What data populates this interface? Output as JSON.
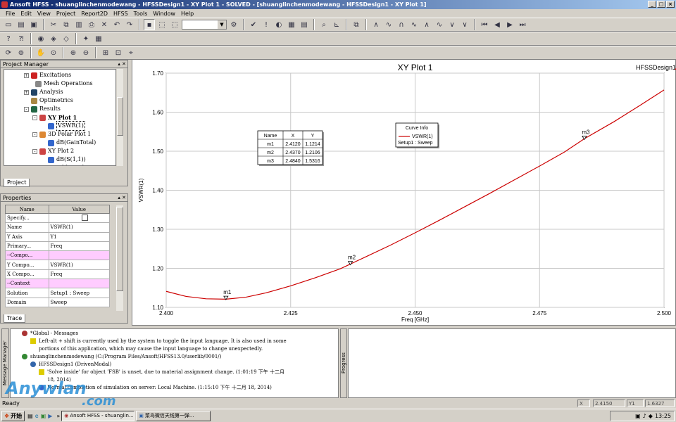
{
  "window": {
    "title": "Ansoft HFSS - shuanglinchenmodewang - HFSSDesign1 - XY Plot 1 - SOLVED - [shuanglinchenmodewang - HFSSDesign1 - XY Plot 1]",
    "buttons": [
      "_",
      "□",
      "×"
    ]
  },
  "menu": [
    "File",
    "Edit",
    "View",
    "Project",
    "Report2D",
    "HFSS",
    "Tools",
    "Window",
    "Help"
  ],
  "project_manager": {
    "title": "Project Manager",
    "tab": "Project",
    "items": [
      {
        "label": "Excitations",
        "expander": "+",
        "icon": "excitations-icon",
        "bold": false
      },
      {
        "label": "Mesh Operations",
        "expander": "",
        "icon": "mesh-icon",
        "bold": false
      },
      {
        "label": "Analysis",
        "expander": "+",
        "icon": "analysis-icon",
        "bold": false
      },
      {
        "label": "Optimetrics",
        "expander": "",
        "icon": "optimetrics-icon",
        "bold": false
      },
      {
        "label": "Results",
        "expander": "-",
        "icon": "results-icon",
        "bold": false
      },
      {
        "label": "XY Plot 1",
        "expander": "-",
        "icon": "xy-plot-icon",
        "bold": true
      },
      {
        "label": "VSWR(1)",
        "expander": "",
        "icon": "trace-icon",
        "bold": false,
        "selected": true
      },
      {
        "label": "3D Polar Plot 1",
        "expander": "-",
        "icon": "polar-plot-icon",
        "bold": false
      },
      {
        "label": "dB(GainTotal)",
        "expander": "",
        "icon": "trace-icon",
        "bold": false
      },
      {
        "label": "XY Plot 2",
        "expander": "-",
        "icon": "xy-plot-icon",
        "bold": false
      },
      {
        "label": "dB(S(1,1))",
        "expander": "",
        "icon": "trace-icon",
        "bold": false
      },
      {
        "label": "Port Field Display",
        "expander": "+",
        "icon": "port-field-icon",
        "bold": false
      }
    ]
  },
  "properties": {
    "title": "Properties",
    "tab": "Trace",
    "headers": [
      "Name",
      "Value"
    ],
    "rows": [
      {
        "name": "Specify...",
        "value": "",
        "checkbox": true,
        "pink": false
      },
      {
        "name": "Name",
        "value": "VSWR(1)",
        "pink": false
      },
      {
        "name": "Y Axis",
        "value": "Y1",
        "pink": false
      },
      {
        "name": "Primary...",
        "value": "Freq",
        "pink": false
      },
      {
        "name": "--Compo...",
        "value": "",
        "pink": true
      },
      {
        "name": "Y Compo...",
        "value": "VSWR(1)",
        "pink": false
      },
      {
        "name": "X Compo...",
        "value": "Freq",
        "pink": false
      },
      {
        "name": "--Context",
        "value": "",
        "pink": true
      },
      {
        "name": "Solution",
        "value": "Setup1 : Sweep",
        "pink": false
      },
      {
        "name": "Domain",
        "value": "Sweep",
        "pink": false
      }
    ]
  },
  "plot": {
    "design_label": "HFSSDesign1",
    "marker_table": {
      "headers": [
        "Name",
        "X",
        "Y"
      ],
      "rows": [
        [
          "m1",
          "2.4120",
          "1.1214"
        ],
        [
          "m2",
          "2.4370",
          "1.2106"
        ],
        [
          "m3",
          "2.4840",
          "1.5316"
        ]
      ]
    },
    "curve_info": {
      "title": "Curve Info",
      "trace": "VSWR(1)",
      "setup": "Setup1 : Sweep"
    },
    "markers": [
      {
        "name": "m1",
        "x": 2.412,
        "y": 1.1214
      },
      {
        "name": "m2",
        "x": 2.437,
        "y": 1.2106
      },
      {
        "name": "m3",
        "x": 2.484,
        "y": 1.5316
      }
    ]
  },
  "chart_data": {
    "type": "line",
    "title": "XY Plot 1",
    "xlabel": "Freq [GHz]",
    "ylabel": "VSWR(1)",
    "xlim": [
      2.4,
      2.5
    ],
    "ylim": [
      1.1,
      1.7
    ],
    "xticks": [
      "2.400",
      "2.425",
      "2.450",
      "2.475",
      "2.500"
    ],
    "yticks": [
      "1.10",
      "1.20",
      "1.30",
      "1.40",
      "1.50",
      "1.60",
      "1.70"
    ],
    "grid": true,
    "legend": "top-center",
    "series": [
      {
        "name": "VSWR(1)",
        "color": "#cc0000",
        "x": [
          2.4,
          2.404,
          2.408,
          2.412,
          2.416,
          2.42,
          2.425,
          2.43,
          2.435,
          2.437,
          2.44,
          2.445,
          2.45,
          2.455,
          2.46,
          2.465,
          2.47,
          2.475,
          2.48,
          2.484,
          2.49,
          2.495,
          2.5
        ],
        "y": [
          1.141,
          1.128,
          1.122,
          1.121,
          1.126,
          1.137,
          1.155,
          1.176,
          1.199,
          1.211,
          1.229,
          1.259,
          1.291,
          1.324,
          1.358,
          1.392,
          1.427,
          1.462,
          1.498,
          1.532,
          1.576,
          1.616,
          1.657
        ]
      }
    ]
  },
  "messages": {
    "side_label": "Message Manager",
    "lines": [
      {
        "text": "*Global - Messages",
        "icon": "global-icon",
        "indent": 1
      },
      {
        "text": "Left-alt + shift is currently used by the system to toggle the input language. It is also used in some",
        "icon": "warning-icon",
        "indent": 2
      },
      {
        "text": "portions of this application, which may cause the input language to change unexpectedly.",
        "icon": "",
        "indent": 2
      },
      {
        "text": "shuanglinchenmodewang (C:/Program Files/Ansoft/HFSS13.0/userlib/0001/)",
        "icon": "project-icon",
        "indent": 1
      },
      {
        "text": "HFSSDesign1 (DrivenModal)",
        "icon": "design-icon",
        "indent": 2
      },
      {
        "text": "'Solve inside' for object 'FSB' is unset, due to material assignment change. (1:01:19 下午  十二月",
        "icon": "warning-icon",
        "indent": 3
      },
      {
        "text": "18, 2014)",
        "icon": "",
        "indent": 3
      },
      {
        "text": "Normal completion of simulation on server: Local Machine. (1:15:10 下午  十二月 18, 2014)",
        "icon": "info-icon",
        "indent": 3
      }
    ]
  },
  "progress": {
    "side_label": "Progress"
  },
  "status": {
    "text": "Ready",
    "x_label": "X",
    "x_value": "2.4150",
    "y_label": "Y1",
    "y_value": "1.6327"
  },
  "taskbar": {
    "start": "开始",
    "tasks": [
      "Ansoft HFSS - shuanglin...",
      "菜鸟微信天线第一弹..."
    ],
    "clock": "13:25"
  },
  "watermark": {
    "line1": "Anywlan",
    "line2": ".com"
  }
}
